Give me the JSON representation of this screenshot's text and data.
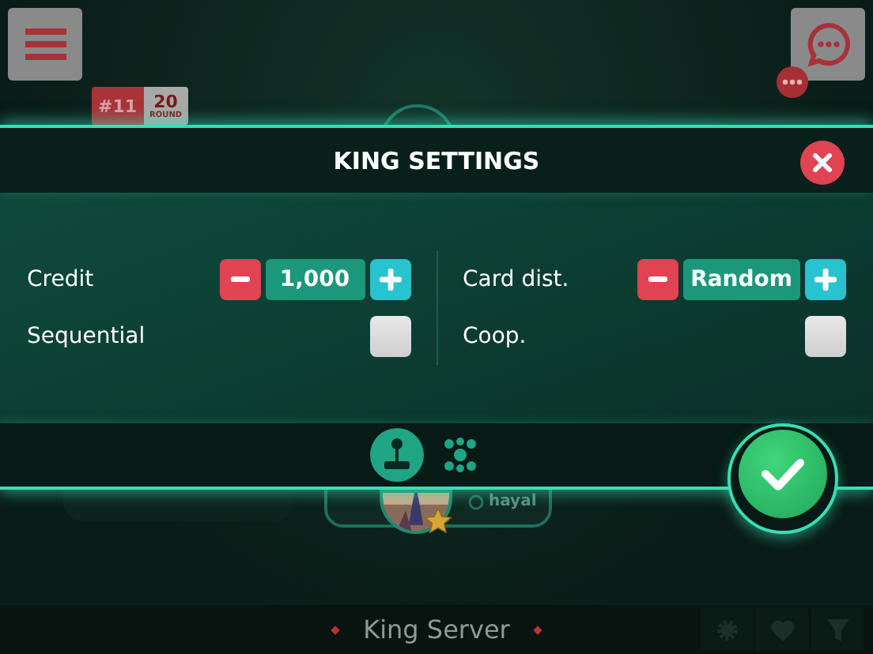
{
  "round_badge": {
    "rank": "#11",
    "round": "20",
    "round_label": "ROUND"
  },
  "dialog": {
    "title": "KING SETTINGS",
    "columns": [
      [
        {
          "kind": "stepper",
          "label": "Credit",
          "value": "1,000"
        },
        {
          "kind": "checkbox",
          "label": "Sequential",
          "checked": false
        }
      ],
      [
        {
          "kind": "stepper",
          "label": "Card dist.",
          "value": "Random"
        },
        {
          "kind": "checkbox",
          "label": "Coop.",
          "checked": false
        }
      ]
    ],
    "tabs": [
      {
        "kind": "joystick",
        "selected": true
      },
      {
        "kind": "group",
        "selected": false
      }
    ]
  },
  "player": {
    "name": "hayal"
  },
  "server": {
    "name": "King Server"
  }
}
